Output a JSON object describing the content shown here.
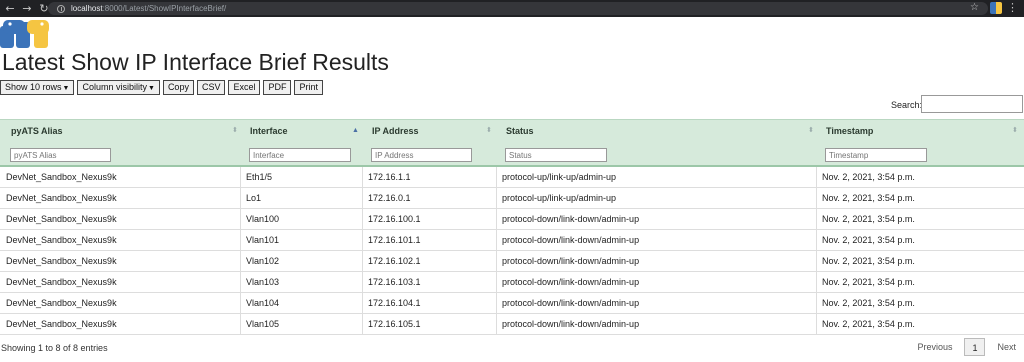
{
  "browser": {
    "url_host": "localhost",
    "url_rest": ":8000/Latest/ShowIPInterfaceBrief/",
    "back_icon": "←",
    "forward_icon": "→",
    "reload_icon": "↻",
    "star_icon": "☆",
    "menu_icon": "⋮"
  },
  "page": {
    "title": "Latest Show IP Interface Brief Results"
  },
  "toolbar": {
    "show_rows": "Show 10 rows",
    "column_visibility": "Column visibility",
    "caret": "▼",
    "copy": "Copy",
    "csv": "CSV",
    "excel": "Excel",
    "pdf": "PDF",
    "print": "Print"
  },
  "search": {
    "label": "Search:",
    "value": ""
  },
  "table": {
    "headers": [
      "pyATS Alias",
      "Interface",
      "IP Address",
      "Status",
      "Timestamp"
    ],
    "filter_placeholders": [
      "pyATS Alias",
      "Interface",
      "IP Address",
      "Status",
      "Timestamp"
    ],
    "sort_icon": "⬍",
    "sort_active_icon": "▲",
    "rows": [
      [
        "DevNet_Sandbox_Nexus9k",
        "Eth1/5",
        "172.16.1.1",
        "protocol-up/link-up/admin-up",
        "Nov. 2, 2021, 3:54 p.m."
      ],
      [
        "DevNet_Sandbox_Nexus9k",
        "Lo1",
        "172.16.0.1",
        "protocol-up/link-up/admin-up",
        "Nov. 2, 2021, 3:54 p.m."
      ],
      [
        "DevNet_Sandbox_Nexus9k",
        "Vlan100",
        "172.16.100.1",
        "protocol-down/link-down/admin-up",
        "Nov. 2, 2021, 3:54 p.m."
      ],
      [
        "DevNet_Sandbox_Nexus9k",
        "Vlan101",
        "172.16.101.1",
        "protocol-down/link-down/admin-up",
        "Nov. 2, 2021, 3:54 p.m."
      ],
      [
        "DevNet_Sandbox_Nexus9k",
        "Vlan102",
        "172.16.102.1",
        "protocol-down/link-down/admin-up",
        "Nov. 2, 2021, 3:54 p.m."
      ],
      [
        "DevNet_Sandbox_Nexus9k",
        "Vlan103",
        "172.16.103.1",
        "protocol-down/link-down/admin-up",
        "Nov. 2, 2021, 3:54 p.m."
      ],
      [
        "DevNet_Sandbox_Nexus9k",
        "Vlan104",
        "172.16.104.1",
        "protocol-down/link-down/admin-up",
        "Nov. 2, 2021, 3:54 p.m."
      ],
      [
        "DevNet_Sandbox_Nexus9k",
        "Vlan105",
        "172.16.105.1",
        "protocol-down/link-down/admin-up",
        "Nov. 2, 2021, 3:54 p.m."
      ]
    ]
  },
  "footer": {
    "info": "Showing 1 to 8 of 8 entries",
    "previous": "Previous",
    "current_page": "1",
    "next": "Next"
  },
  "colors": {
    "header_bg": "#d6eadb",
    "chrome_bg": "#202124",
    "logo_blue": "#3b73b9",
    "logo_yellow": "#f5c542"
  }
}
